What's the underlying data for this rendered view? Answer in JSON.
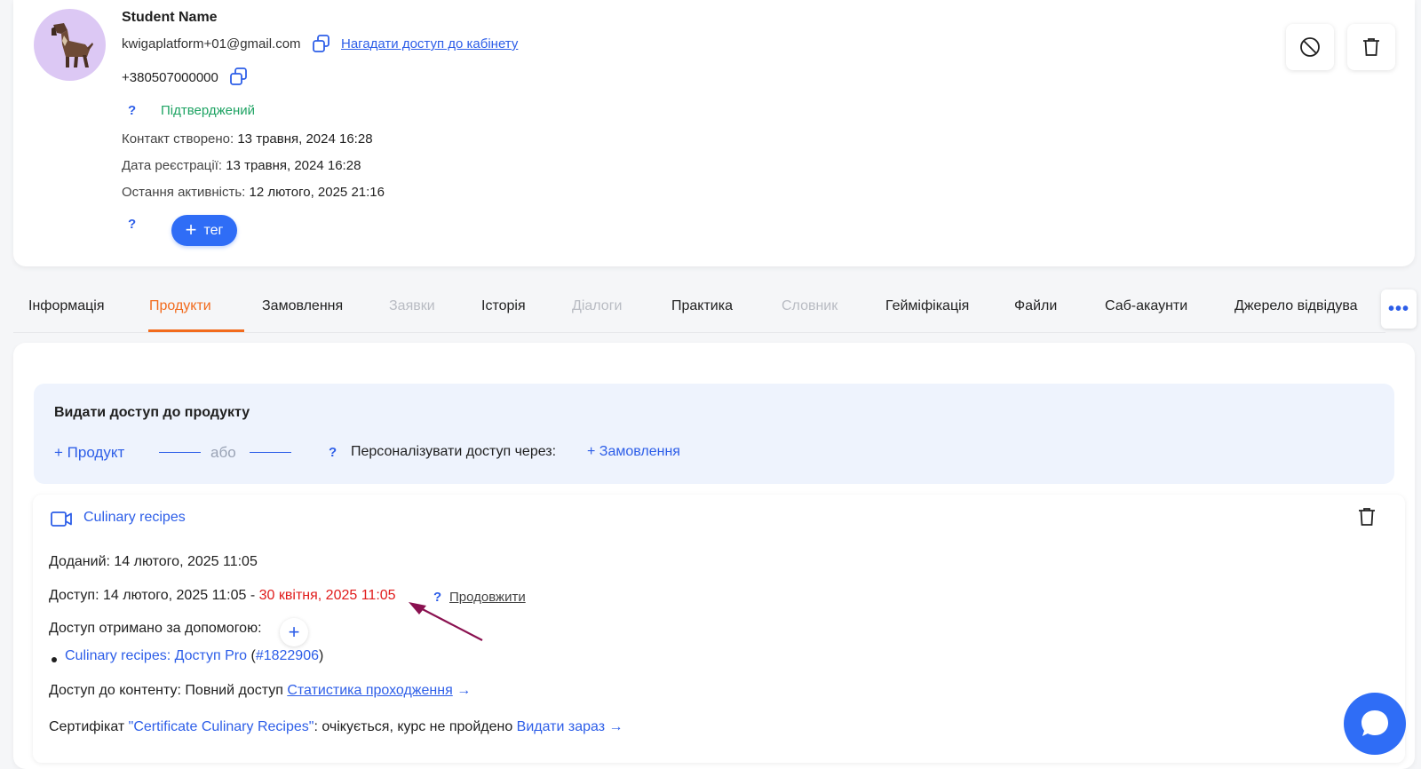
{
  "profile": {
    "name": "Student Name",
    "email": "kwigaplatform+01@gmail.com",
    "remind_link": "Нагадати доступ до кабінету",
    "phone": "+380507000000",
    "question_mark": "?",
    "status": "Підтверджений",
    "created_label": "Контакт створено:",
    "created_value": "13 травня, 2024 16:28",
    "registered_label": "Дата реєстрації:",
    "registered_value": "13 травня, 2024 16:28",
    "activity_label": "Остання активність:",
    "activity_value": "12 лютого, 2025 21:16",
    "tag_button": "тег"
  },
  "tabs": [
    {
      "label": "Інформація"
    },
    {
      "label": "Продукти"
    },
    {
      "label": "Замовлення"
    },
    {
      "label": "Заявки"
    },
    {
      "label": "Історія"
    },
    {
      "label": "Діалоги"
    },
    {
      "label": "Практика"
    },
    {
      "label": "Словник"
    },
    {
      "label": "Гейміфікація"
    },
    {
      "label": "Файли"
    },
    {
      "label": "Саб-акаунти"
    },
    {
      "label": "Джерело відвідува"
    }
  ],
  "more_button": "•••",
  "grant": {
    "title": "Видати доступ до продукту",
    "add_product": "+ Продукт",
    "or": "або",
    "personalize_label": "Персоналізувати доступ через:",
    "add_order": "+ Замовлення"
  },
  "product": {
    "title": "Culinary recipes",
    "added_label": "Доданий:",
    "added_value": "14 лютого, 2025 11:05",
    "access_label": "Доступ:",
    "access_from": "14 лютого, 2025 11:05",
    "access_dash": "-",
    "access_to": "30 квітня, 2025 11:05",
    "extend_link": "Продовжити",
    "received_via_label": "Доступ отримано за допомогою:",
    "via_item_link": "Culinary recipes: Доступ Pro",
    "via_item_order": "#1822906",
    "content_label": "Доступ до контенту:",
    "content_value": "Повний доступ",
    "stats_link": "Статистика проходження",
    "arrow": "→",
    "cert_prefix": "Сертифікат",
    "cert_name": "\"Certificate Culinary Recipes\"",
    "cert_status": ": очікується, курс не пройдено",
    "cert_issue_link": "Видати зараз"
  },
  "colors": {
    "accent": "#2f6df6",
    "link": "#2d5ee8",
    "active_tab": "#f26b1d",
    "confirmed": "#1ea363",
    "expiry": "#e01b1b",
    "annotation_arrow": "#8a1150"
  }
}
